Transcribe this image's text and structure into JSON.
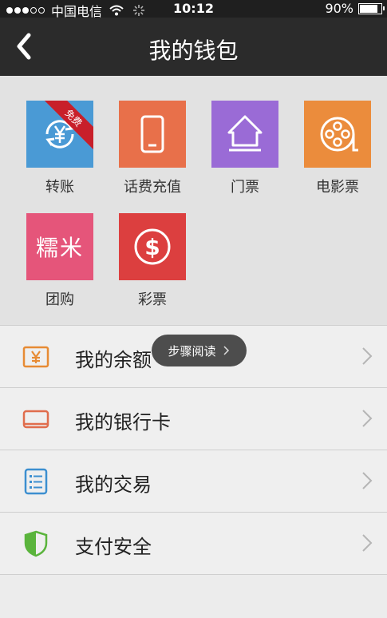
{
  "status_bar": {
    "carrier": "中国电信",
    "time": "10:12",
    "battery": "90%"
  },
  "nav": {
    "title": "我的钱包"
  },
  "grid": {
    "items": [
      {
        "label": "转账",
        "icon": "yuan-exchange-icon",
        "color": "#4a9ad5",
        "badge": "免费"
      },
      {
        "label": "话费充值",
        "icon": "phone-icon",
        "color": "#e8704a"
      },
      {
        "label": "门票",
        "icon": "house-icon",
        "color": "#9a6bd6"
      },
      {
        "label": "电影票",
        "icon": "film-reel-icon",
        "color": "#eb8c3c"
      },
      {
        "label": "团购",
        "icon": "nuomi-logo",
        "color": "#e5557a",
        "logo_text": "糯米"
      },
      {
        "label": "彩票",
        "icon": "dollar-icon",
        "color": "#dc3f3f"
      }
    ]
  },
  "list": {
    "items": [
      {
        "label": "我的余额",
        "icon": "yuan-box-icon",
        "color": "#e78b34"
      },
      {
        "label": "我的银行卡",
        "icon": "laptop-icon",
        "color": "#e06d4d"
      },
      {
        "label": "我的交易",
        "icon": "list-icon",
        "color": "#3c8fd0"
      },
      {
        "label": "支付安全",
        "icon": "shield-icon",
        "color": "#5ab43c"
      }
    ]
  },
  "toast": {
    "label": "步骤阅读"
  }
}
